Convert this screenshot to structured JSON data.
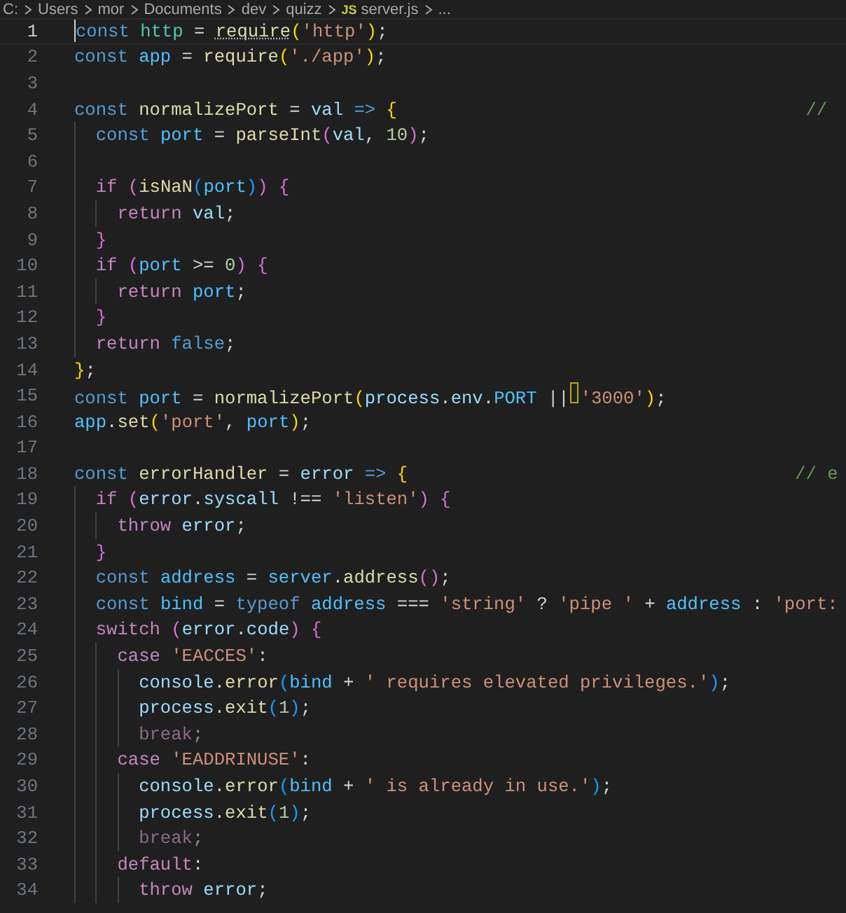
{
  "breadcrumb": {
    "items": [
      {
        "label": "C:",
        "kind": "folder"
      },
      {
        "label": "Users",
        "kind": "folder"
      },
      {
        "label": "mor",
        "kind": "folder"
      },
      {
        "label": "Documents",
        "kind": "folder"
      },
      {
        "label": "dev",
        "kind": "folder"
      },
      {
        "label": "quizz",
        "kind": "folder"
      },
      {
        "label": "server.js",
        "kind": "file",
        "file_icon_label": "JS"
      },
      {
        "label": "...",
        "kind": "more"
      }
    ]
  },
  "editor": {
    "lines": [
      {
        "number": "1",
        "current": true,
        "tokens": [
          {
            "text": "const ",
            "kind": "keyword"
          },
          {
            "text": "http",
            "kind": "type"
          },
          {
            "text": " = ",
            "kind": "plain"
          },
          {
            "text": "require",
            "kind": "func",
            "hint": true
          },
          {
            "text": "(",
            "kind": "bracket1"
          },
          {
            "text": "'http'",
            "kind": "string"
          },
          {
            "text": ")",
            "kind": "bracket1"
          },
          {
            "text": ";",
            "kind": "plain"
          }
        ]
      },
      {
        "number": "2",
        "current": false,
        "tokens": [
          {
            "text": "const ",
            "kind": "keyword"
          },
          {
            "text": "app",
            "kind": "const"
          },
          {
            "text": " = ",
            "kind": "plain"
          },
          {
            "text": "require",
            "kind": "func"
          },
          {
            "text": "(",
            "kind": "bracket1"
          },
          {
            "text": "'./app'",
            "kind": "string"
          },
          {
            "text": ")",
            "kind": "bracket1"
          },
          {
            "text": ";",
            "kind": "plain"
          }
        ]
      },
      {
        "number": "3",
        "current": false
      },
      {
        "number": "4",
        "current": false,
        "tokens": [
          {
            "text": "const ",
            "kind": "keyword"
          },
          {
            "text": "normalizePort",
            "kind": "func"
          },
          {
            "text": " = ",
            "kind": "plain"
          },
          {
            "text": "val ",
            "kind": "var"
          },
          {
            "text": "=> ",
            "kind": "keyword"
          },
          {
            "text": "{                                      ",
            "kind": "bracket1"
          },
          {
            "text": "//",
            "kind": "comment"
          }
        ]
      },
      {
        "number": "5",
        "current": false,
        "tokens": [
          {
            "text": "  const ",
            "kind": "keyword"
          },
          {
            "text": "port",
            "kind": "const"
          },
          {
            "text": " = ",
            "kind": "plain"
          },
          {
            "text": "parseInt",
            "kind": "func"
          },
          {
            "text": "(",
            "kind": "bracket2"
          },
          {
            "text": "val",
            "kind": "var"
          },
          {
            "text": ", ",
            "kind": "plain"
          },
          {
            "text": "10",
            "kind": "number"
          },
          {
            "text": ")",
            "kind": "bracket2"
          },
          {
            "text": ";",
            "kind": "plain"
          }
        ]
      },
      {
        "number": "6",
        "current": false
      },
      {
        "number": "7",
        "current": false,
        "tokens": [
          {
            "text": "  if ",
            "kind": "control"
          },
          {
            "text": "(",
            "kind": "bracket2"
          },
          {
            "text": "isNaN",
            "kind": "func"
          },
          {
            "text": "(",
            "kind": "bracket3"
          },
          {
            "text": "port",
            "kind": "const"
          },
          {
            "text": ")",
            "kind": "bracket3"
          },
          {
            "text": ") ",
            "kind": "bracket2"
          },
          {
            "text": "{",
            "kind": "bracket2"
          }
        ]
      },
      {
        "number": "8",
        "current": false,
        "tokens": [
          {
            "text": "    return ",
            "kind": "control"
          },
          {
            "text": "val",
            "kind": "var"
          },
          {
            "text": ";",
            "kind": "plain"
          }
        ]
      },
      {
        "number": "9",
        "current": false,
        "tokens": [
          {
            "text": "  }",
            "kind": "bracket2"
          }
        ]
      },
      {
        "number": "10",
        "current": false,
        "tokens": [
          {
            "text": "  if ",
            "kind": "control"
          },
          {
            "text": "(",
            "kind": "bracket2"
          },
          {
            "text": "port",
            "kind": "const"
          },
          {
            "text": " >= ",
            "kind": "plain"
          },
          {
            "text": "0",
            "kind": "number"
          },
          {
            "text": ") ",
            "kind": "bracket2"
          },
          {
            "text": "{",
            "kind": "bracket2"
          }
        ]
      },
      {
        "number": "11",
        "current": false,
        "tokens": [
          {
            "text": "    return ",
            "kind": "control"
          },
          {
            "text": "port",
            "kind": "const"
          },
          {
            "text": ";",
            "kind": "plain"
          }
        ]
      },
      {
        "number": "12",
        "current": false,
        "tokens": [
          {
            "text": "  }",
            "kind": "bracket2"
          }
        ]
      },
      {
        "number": "13",
        "current": false,
        "tokens": [
          {
            "text": "  return ",
            "kind": "control"
          },
          {
            "text": "false",
            "kind": "keyword"
          },
          {
            "text": ";",
            "kind": "plain"
          }
        ]
      },
      {
        "number": "14",
        "current": false,
        "tokens": [
          {
            "text": "}",
            "kind": "bracket1"
          },
          {
            "text": ";",
            "kind": "plain"
          }
        ]
      },
      {
        "number": "15",
        "current": false,
        "tokens": [
          {
            "text": "const ",
            "kind": "keyword"
          },
          {
            "text": "port",
            "kind": "const"
          },
          {
            "text": " = ",
            "kind": "plain"
          },
          {
            "text": "normalizePort",
            "kind": "func"
          },
          {
            "text": "(",
            "kind": "bracket1"
          },
          {
            "text": "process",
            "kind": "var"
          },
          {
            "text": ".",
            "kind": "plain"
          },
          {
            "text": "env",
            "kind": "var"
          },
          {
            "text": ".",
            "kind": "plain"
          },
          {
            "text": "PORT",
            "kind": "const"
          },
          {
            "text": " ||",
            "kind": "plain"
          },
          {
            "kind": "marker"
          },
          {
            "text": "'3000'",
            "kind": "string"
          },
          {
            "text": ")",
            "kind": "bracket1"
          },
          {
            "text": ";",
            "kind": "plain"
          }
        ]
      },
      {
        "number": "16",
        "current": false,
        "tokens": [
          {
            "text": "app",
            "kind": "const"
          },
          {
            "text": ".",
            "kind": "plain"
          },
          {
            "text": "set",
            "kind": "func"
          },
          {
            "text": "(",
            "kind": "bracket1"
          },
          {
            "text": "'port'",
            "kind": "string"
          },
          {
            "text": ", ",
            "kind": "plain"
          },
          {
            "text": "port",
            "kind": "const"
          },
          {
            "text": ")",
            "kind": "bracket1"
          },
          {
            "text": ";",
            "kind": "plain"
          }
        ]
      },
      {
        "number": "17",
        "current": false
      },
      {
        "number": "18",
        "current": false,
        "tokens": [
          {
            "text": "const ",
            "kind": "keyword"
          },
          {
            "text": "errorHandler",
            "kind": "func"
          },
          {
            "text": " = ",
            "kind": "plain"
          },
          {
            "text": "error ",
            "kind": "var"
          },
          {
            "text": "=> ",
            "kind": "keyword"
          },
          {
            "text": "{                                    ",
            "kind": "bracket1"
          },
          {
            "text": "// e",
            "kind": "comment"
          }
        ]
      },
      {
        "number": "19",
        "current": false,
        "tokens": [
          {
            "text": "  if ",
            "kind": "control"
          },
          {
            "text": "(",
            "kind": "bracket2"
          },
          {
            "text": "error",
            "kind": "var"
          },
          {
            "text": ".",
            "kind": "plain"
          },
          {
            "text": "syscall",
            "kind": "var"
          },
          {
            "text": " !== ",
            "kind": "plain"
          },
          {
            "text": "'listen'",
            "kind": "string"
          },
          {
            "text": ") ",
            "kind": "bracket2"
          },
          {
            "text": "{",
            "kind": "bracket2"
          }
        ]
      },
      {
        "number": "20",
        "current": false,
        "tokens": [
          {
            "text": "    throw ",
            "kind": "control"
          },
          {
            "text": "error",
            "kind": "var"
          },
          {
            "text": ";",
            "kind": "plain"
          }
        ]
      },
      {
        "number": "21",
        "current": false,
        "tokens": [
          {
            "text": "  }",
            "kind": "bracket2"
          }
        ]
      },
      {
        "number": "22",
        "current": false,
        "tokens": [
          {
            "text": "  const ",
            "kind": "keyword"
          },
          {
            "text": "address",
            "kind": "const"
          },
          {
            "text": " = ",
            "kind": "plain"
          },
          {
            "text": "server",
            "kind": "const"
          },
          {
            "text": ".",
            "kind": "plain"
          },
          {
            "text": "address",
            "kind": "func"
          },
          {
            "text": "()",
            "kind": "bracket2"
          },
          {
            "text": ";",
            "kind": "plain"
          }
        ]
      },
      {
        "number": "23",
        "current": false,
        "tokens": [
          {
            "text": "  const ",
            "kind": "keyword"
          },
          {
            "text": "bind",
            "kind": "const"
          },
          {
            "text": " = ",
            "kind": "plain"
          },
          {
            "text": "typeof ",
            "kind": "keyword"
          },
          {
            "text": "address",
            "kind": "const"
          },
          {
            "text": " === ",
            "kind": "plain"
          },
          {
            "text": "'string'",
            "kind": "string"
          },
          {
            "text": " ? ",
            "kind": "plain"
          },
          {
            "text": "'pipe '",
            "kind": "string"
          },
          {
            "text": " + ",
            "kind": "plain"
          },
          {
            "text": "address",
            "kind": "const"
          },
          {
            "text": " : ",
            "kind": "plain"
          },
          {
            "text": "'port:",
            "kind": "string"
          }
        ]
      },
      {
        "number": "24",
        "current": false,
        "tokens": [
          {
            "text": "  switch ",
            "kind": "control"
          },
          {
            "text": "(",
            "kind": "bracket2"
          },
          {
            "text": "error",
            "kind": "var"
          },
          {
            "text": ".",
            "kind": "plain"
          },
          {
            "text": "code",
            "kind": "var"
          },
          {
            "text": ") ",
            "kind": "bracket2"
          },
          {
            "text": "{",
            "kind": "bracket2"
          }
        ]
      },
      {
        "number": "25",
        "current": false,
        "tokens": [
          {
            "text": "    case ",
            "kind": "control"
          },
          {
            "text": "'EACCES'",
            "kind": "string"
          },
          {
            "text": ":",
            "kind": "plain"
          }
        ]
      },
      {
        "number": "26",
        "current": false,
        "tokens": [
          {
            "text": "      console",
            "kind": "var"
          },
          {
            "text": ".",
            "kind": "plain"
          },
          {
            "text": "error",
            "kind": "func"
          },
          {
            "text": "(",
            "kind": "bracket3"
          },
          {
            "text": "bind",
            "kind": "const"
          },
          {
            "text": " + ",
            "kind": "plain"
          },
          {
            "text": "' requires elevated privileges.'",
            "kind": "string"
          },
          {
            "text": ")",
            "kind": "bracket3"
          },
          {
            "text": ";",
            "kind": "plain"
          }
        ]
      },
      {
        "number": "27",
        "current": false,
        "tokens": [
          {
            "text": "      process",
            "kind": "var"
          },
          {
            "text": ".",
            "kind": "plain"
          },
          {
            "text": "exit",
            "kind": "func"
          },
          {
            "text": "(",
            "kind": "bracket3"
          },
          {
            "text": "1",
            "kind": "number"
          },
          {
            "text": ")",
            "kind": "bracket3"
          },
          {
            "text": ";",
            "kind": "plain"
          }
        ]
      },
      {
        "number": "28",
        "current": false,
        "tokens": [
          {
            "text": "      break",
            "kind": "control-dim"
          },
          {
            "text": ";",
            "kind": "plain-dim"
          }
        ]
      },
      {
        "number": "29",
        "current": false,
        "tokens": [
          {
            "text": "    case ",
            "kind": "control"
          },
          {
            "text": "'EADDRINUSE'",
            "kind": "string"
          },
          {
            "text": ":",
            "kind": "plain"
          }
        ]
      },
      {
        "number": "30",
        "current": false,
        "tokens": [
          {
            "text": "      console",
            "kind": "var"
          },
          {
            "text": ".",
            "kind": "plain"
          },
          {
            "text": "error",
            "kind": "func"
          },
          {
            "text": "(",
            "kind": "bracket3"
          },
          {
            "text": "bind",
            "kind": "const"
          },
          {
            "text": " + ",
            "kind": "plain"
          },
          {
            "text": "' is already in use.'",
            "kind": "string"
          },
          {
            "text": ")",
            "kind": "bracket3"
          },
          {
            "text": ";",
            "kind": "plain"
          }
        ]
      },
      {
        "number": "31",
        "current": false,
        "tokens": [
          {
            "text": "      process",
            "kind": "var"
          },
          {
            "text": ".",
            "kind": "plain"
          },
          {
            "text": "exit",
            "kind": "func"
          },
          {
            "text": "(",
            "kind": "bracket3"
          },
          {
            "text": "1",
            "kind": "number"
          },
          {
            "text": ")",
            "kind": "bracket3"
          },
          {
            "text": ";",
            "kind": "plain"
          }
        ]
      },
      {
        "number": "32",
        "current": false,
        "tokens": [
          {
            "text": "      break",
            "kind": "control-dim"
          },
          {
            "text": ";",
            "kind": "plain-dim"
          }
        ]
      },
      {
        "number": "33",
        "current": false,
        "tokens": [
          {
            "text": "    default",
            "kind": "control"
          },
          {
            "text": ":",
            "kind": "plain"
          }
        ]
      },
      {
        "number": "34",
        "current": false,
        "tokens": [
          {
            "text": "      throw ",
            "kind": "control"
          },
          {
            "text": "error",
            "kind": "var"
          },
          {
            "text": ";",
            "kind": "plain"
          }
        ]
      }
    ]
  }
}
